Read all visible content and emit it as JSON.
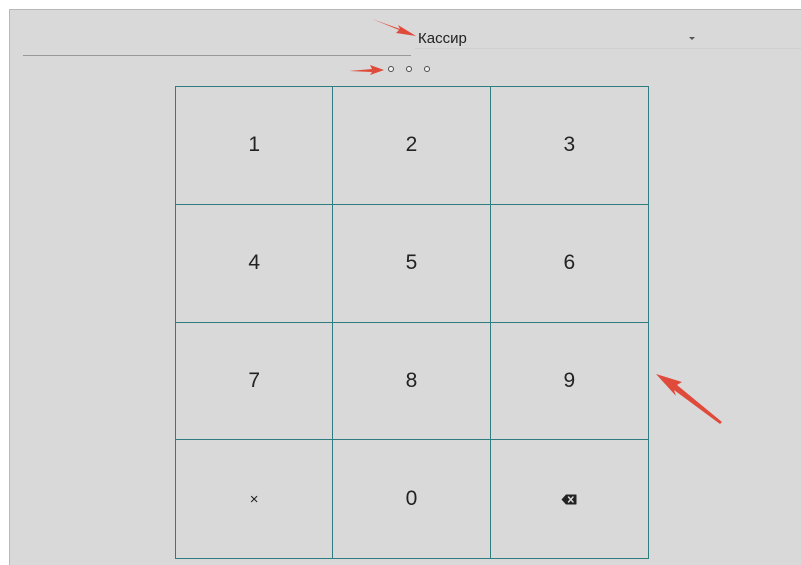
{
  "role_select": {
    "value": "Кассир",
    "caret_icon": "caret-down-icon"
  },
  "pin": {
    "length": 3,
    "filled": 0
  },
  "keypad": {
    "keys": [
      {
        "label": "1",
        "name": "key-1"
      },
      {
        "label": "2",
        "name": "key-2"
      },
      {
        "label": "3",
        "name": "key-3"
      },
      {
        "label": "4",
        "name": "key-4"
      },
      {
        "label": "5",
        "name": "key-5"
      },
      {
        "label": "6",
        "name": "key-6"
      },
      {
        "label": "7",
        "name": "key-7"
      },
      {
        "label": "8",
        "name": "key-8"
      },
      {
        "label": "9",
        "name": "key-9"
      },
      {
        "label": "×",
        "name": "clear-key"
      },
      {
        "label": "0",
        "name": "key-0"
      },
      {
        "label": "",
        "name": "backspace-key",
        "icon": "backspace-icon"
      }
    ]
  },
  "annotations": {
    "arrow_color": "#e04a3a",
    "arrows": [
      "arrow-to-role-select",
      "arrow-to-pin-dots",
      "arrow-to-keypad"
    ]
  }
}
